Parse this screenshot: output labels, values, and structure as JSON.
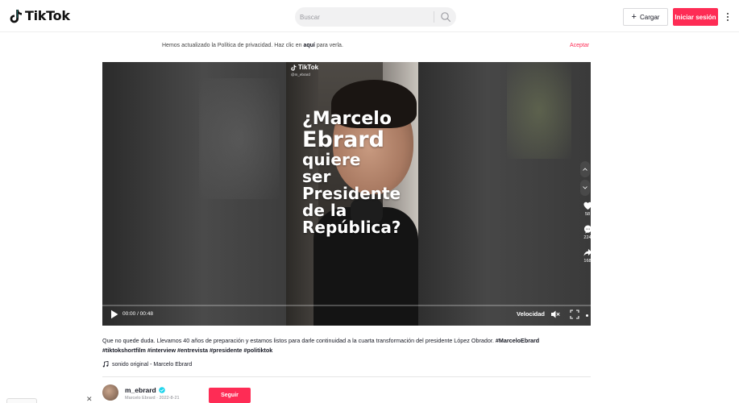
{
  "header": {
    "logo_text": "TikTok",
    "search_placeholder": "Buscar",
    "upload_label": "Cargar",
    "login_label": "Iniciar sesión"
  },
  "privacy": {
    "text_before": "Hemos actualizado la Política de privacidad. Haz clic en ",
    "link": "aquí",
    "text_after": " para verla.",
    "accept_label": "Aceptar"
  },
  "video": {
    "overlay_brand": "TikTok",
    "overlay_user": "@m_ebrard",
    "headline_lines": [
      "¿Marcelo",
      "Ebrard",
      "quiere",
      "ser",
      "Presidente",
      "de la",
      "República?"
    ],
    "time": "00:00 / 00:48",
    "speed_label": "Velocidad",
    "likes": "58",
    "comments": "224",
    "shares": "168"
  },
  "description": {
    "text": "Que no quede duda. Llevamos 40 años de preparación y estamos listos para darle continuidad a la cuarta transformación del presidente López Obrador.",
    "hashtag_1": "#MarceloEbrard",
    "hashtags_rest": "#tiktokshortfilm #interview #entrevista #presidente #politiktok",
    "music": "sonido original - Marcelo Ebrard"
  },
  "author": {
    "username": "m_ebrard",
    "meta": "Marcelo Ebrard · 2022-8-21",
    "follow_label": "Seguir"
  },
  "colors": {
    "brand_red": "#fe2c55",
    "verified_blue": "#20d5ec"
  }
}
